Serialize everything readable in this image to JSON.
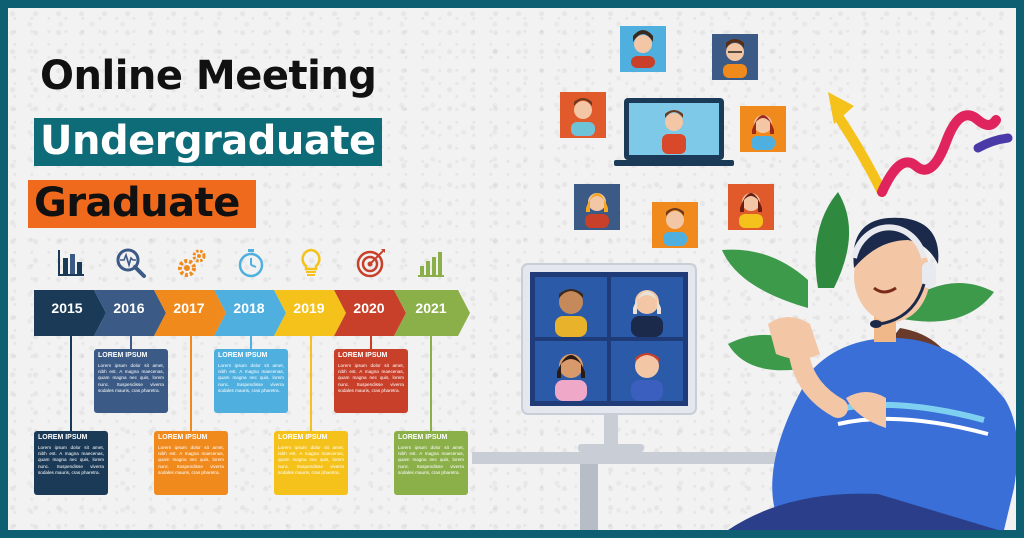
{
  "titles": {
    "line1": "Online Meeting",
    "line2": "Undergraduate",
    "line3": "Graduate"
  },
  "timeline": {
    "years": [
      "2015",
      "2016",
      "2017",
      "2018",
      "2019",
      "2020",
      "2021"
    ],
    "colors": [
      "#1b3a57",
      "#3b5a85",
      "#f08a1c",
      "#4fb0e0",
      "#f5c21b",
      "#c8402a",
      "#8bb04a"
    ],
    "icons": [
      "bar-chart-icon",
      "magnifier-pulse-icon",
      "gears-icon",
      "stopwatch-icon",
      "lightbulb-icon",
      "target-icon",
      "growth-chart-icon"
    ],
    "cards": [
      {
        "title": "LOREM IPSUM",
        "body": "Lorem ipsum dolor sit amet, nibh est. A magna maecenas, quam magna nec quis, lorem nunc. Suspendisse viverra sodales mauris, cras pharetra."
      },
      {
        "title": "LOREM IPSUM",
        "body": "Lorem ipsum dolor sit amet, nibh est. A magna maecenas, quam magna nec quis, lorem nunc. Suspendisse viverra sodales mauris, cras pharetra."
      },
      {
        "title": "LOREM IPSUM",
        "body": "Lorem ipsum dolor sit amet, nibh est. A magna maecenas, quam magna nec quis, lorem nunc. Suspendisse viverra sodales mauris, cras pharetra."
      },
      {
        "title": "LOREM IPSUM",
        "body": "Lorem ipsum dolor sit amet, nibh est. A magna maecenas, quam magna nec quis, lorem nunc. Suspendisse viverra sodales mauris, cras pharetra."
      },
      {
        "title": "LOREM IPSUM",
        "body": "Lorem ipsum dolor sit amet, nibh est. A magna maecenas, quam magna nec quis, lorem nunc. Suspendisse viverra sodales mauris, cras pharetra."
      },
      {
        "title": "LOREM IPSUM",
        "body": "Lorem ipsum dolor sit amet, nibh est. A magna maecenas, quam magna nec quis, lorem nunc. Suspendisse viverra sodales mauris, cras pharetra."
      },
      {
        "title": "LOREM IPSUM",
        "body": "Lorem ipsum dolor sit amet, nibh est. A magna maecenas, quam magna nec quis, lorem nunc. Suspendisse viverra sodales mauris, cras pharetra."
      }
    ]
  },
  "illustration": {
    "frame_color": "#0f5f73",
    "accent_orange": "#ef6a1d",
    "accent_teal": "#0e6b78"
  }
}
